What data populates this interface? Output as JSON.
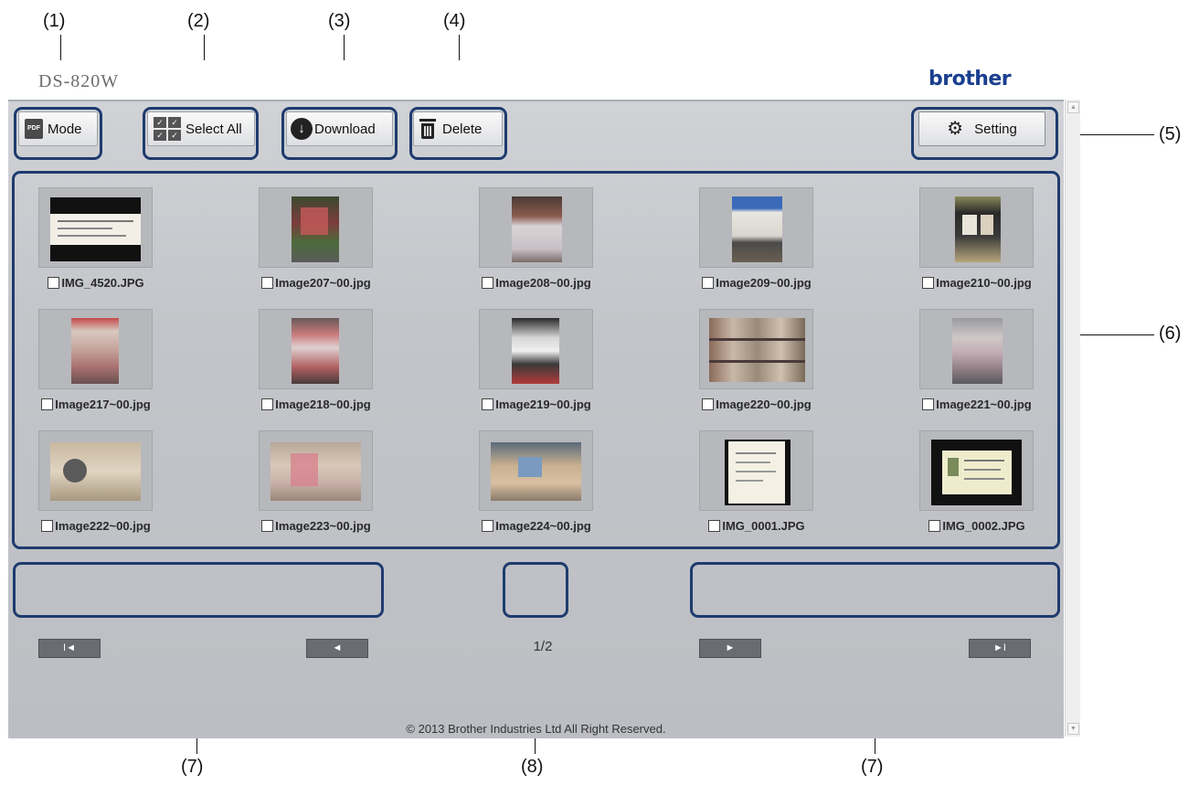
{
  "callouts": [
    "(1)",
    "(2)",
    "(3)",
    "(4)",
    "(5)",
    "(6)",
    "(7)",
    "(8)",
    "(7)"
  ],
  "header": {
    "model": "DS-820W",
    "brand": "brother"
  },
  "toolbar": {
    "mode_label": "Mode",
    "mode_icon": "pdf-icon",
    "mode_icon_text": "PDF",
    "select_all_label": "Select All",
    "download_label": "Download",
    "delete_label": "Delete",
    "setting_label": "Setting"
  },
  "thumbnails": [
    {
      "name": "IMG_4520.JPG",
      "checked": false
    },
    {
      "name": "Image207~00.jpg",
      "checked": false
    },
    {
      "name": "Image208~00.jpg",
      "checked": false
    },
    {
      "name": "Image209~00.jpg",
      "checked": false
    },
    {
      "name": "Image210~00.jpg",
      "checked": false
    },
    {
      "name": "Image217~00.jpg",
      "checked": false
    },
    {
      "name": "Image218~00.jpg",
      "checked": false
    },
    {
      "name": "Image219~00.jpg",
      "checked": false
    },
    {
      "name": "Image220~00.jpg",
      "checked": false
    },
    {
      "name": "Image221~00.jpg",
      "checked": false
    },
    {
      "name": "Image222~00.jpg",
      "checked": false
    },
    {
      "name": "Image223~00.jpg",
      "checked": false
    },
    {
      "name": "Image224~00.jpg",
      "checked": false
    },
    {
      "name": "IMG_0001.JPG",
      "checked": false
    },
    {
      "name": "IMG_0002.JPG",
      "checked": false
    }
  ],
  "pagination": {
    "first_glyph": "I◄",
    "prev_glyph": "◄",
    "next_glyph": "►",
    "last_glyph": "►I",
    "indicator": "1/2"
  },
  "footer": {
    "copyright": "© 2013 Brother Industries Ltd All Right Reserved."
  },
  "colors": {
    "brand": "#1a3f8f",
    "highlight": "#1e3b6e",
    "content_bg": "#c3c5ca",
    "nav_button": "#6a6c71"
  }
}
